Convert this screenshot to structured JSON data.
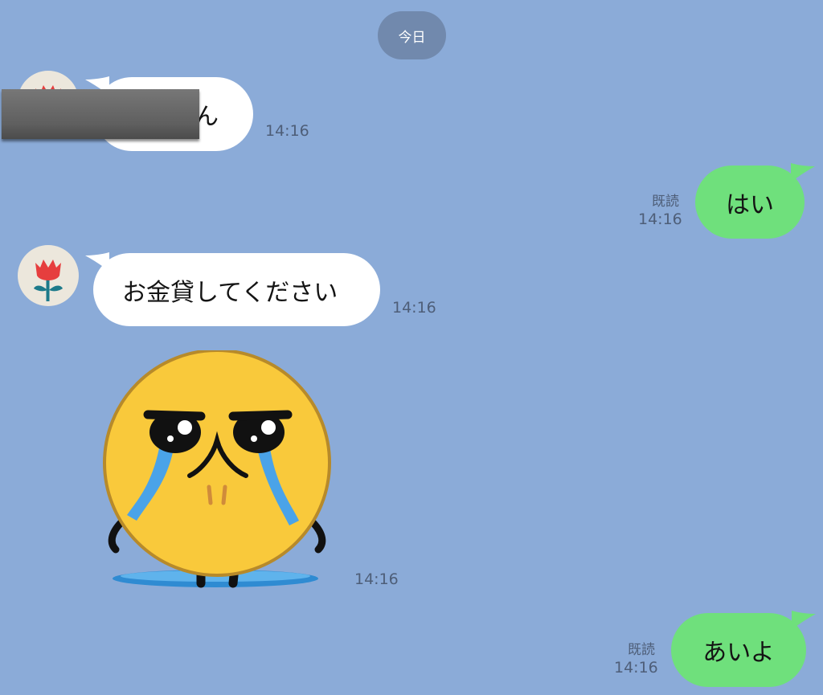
{
  "date_separator": "今日",
  "messages": [
    {
      "text": "ん",
      "time": "14:16"
    },
    {
      "text": "はい",
      "time": "14:16",
      "read": "既読"
    },
    {
      "text": "お金貸してください",
      "time": "14:16"
    },
    {
      "sticker": "crying-emoji-sticker",
      "time": "14:16"
    },
    {
      "text": "あいよ",
      "time": "14:16",
      "read": "既読"
    }
  ],
  "colors": {
    "background": "#8babd8",
    "incoming_bubble": "#ffffff",
    "outgoing_bubble": "#6fe07c",
    "date_pill": "#7189ad"
  },
  "icons": {
    "avatar": "red-tulip-icon",
    "redaction": "gray-redaction-bar"
  }
}
